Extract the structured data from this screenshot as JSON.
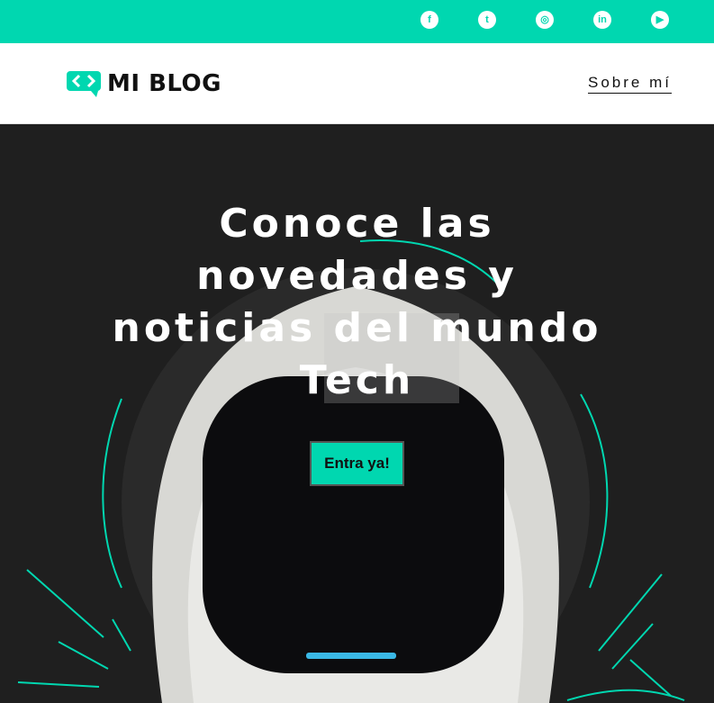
{
  "social": [
    "facebook-icon",
    "tumblr-icon",
    "instagram-icon",
    "linkedin-icon",
    "youtube-icon"
  ],
  "social_glyphs": {
    "facebook": "f",
    "tumblr": "t",
    "instagram": "◎",
    "linkedin": "in",
    "youtube": "▶"
  },
  "header": {
    "logo_text": "MI BLOG",
    "nav_about": "Sobre mí"
  },
  "hero": {
    "title": "Conoce las novedades y noticias del mundo Tech",
    "cta": "Entra ya!"
  },
  "colors": {
    "accent": "#00d7b0",
    "dark": "#1f1f1f"
  }
}
